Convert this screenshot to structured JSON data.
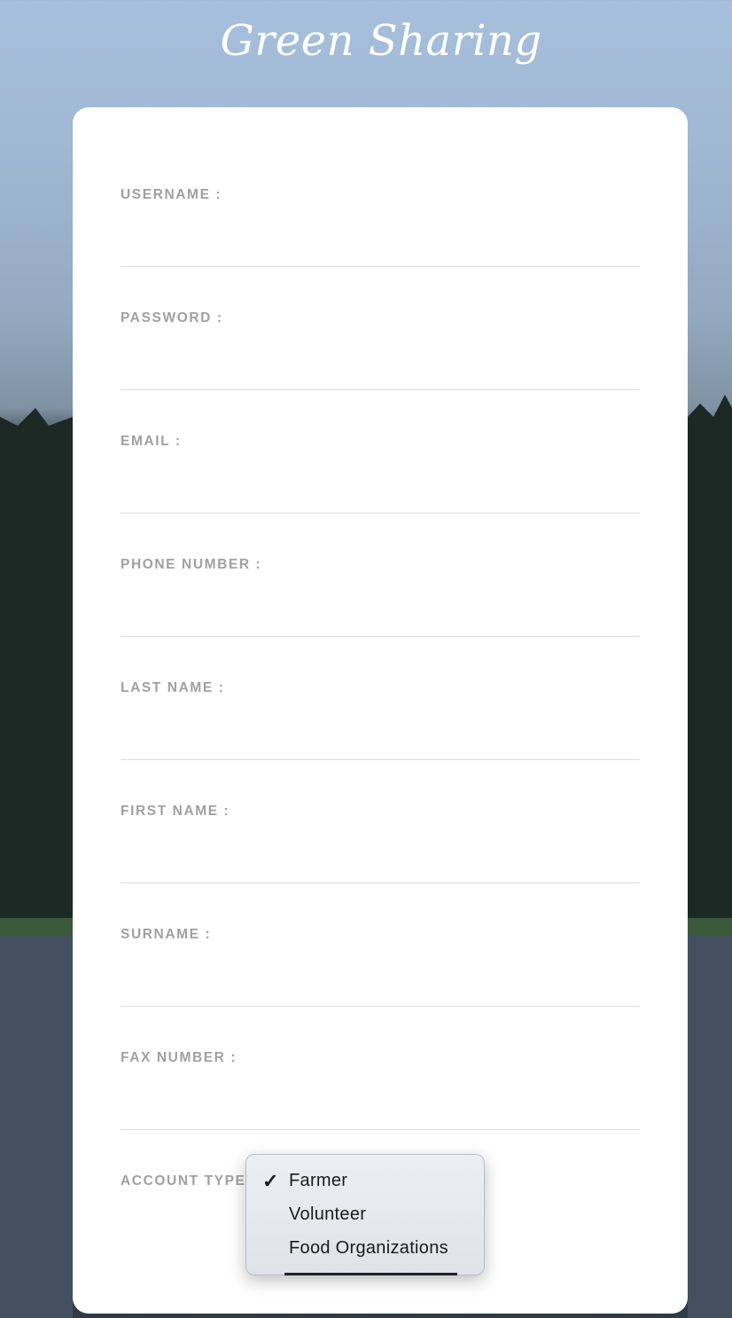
{
  "app": {
    "title": "Green Sharing"
  },
  "form": {
    "fields": [
      {
        "label": "USERNAME :",
        "value": ""
      },
      {
        "label": "PASSWORD :",
        "value": ""
      },
      {
        "label": "EMAIL :",
        "value": ""
      },
      {
        "label": "PHONE NUMBER :",
        "value": ""
      },
      {
        "label": "LAST NAME :",
        "value": ""
      },
      {
        "label": "FIRST NAME :",
        "value": ""
      },
      {
        "label": "SURNAME :",
        "value": ""
      },
      {
        "label": "FAX NUMBER :",
        "value": ""
      }
    ],
    "account_type": {
      "label": "ACCOUNT TYPE",
      "selected": "Farmer",
      "options": [
        "Farmer",
        "Volunteer",
        "Food Organizations"
      ],
      "check_icon": "checkmark-icon"
    }
  },
  "colors": {
    "card": "#ffffff",
    "label": "#a0a0a0",
    "divider": "#dcdcdc",
    "title": "#ffffff"
  }
}
